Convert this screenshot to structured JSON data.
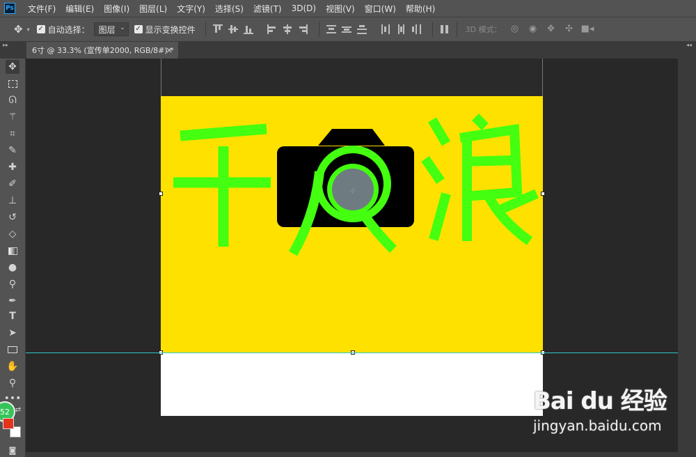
{
  "menubar": {
    "logo": "Ps",
    "items": [
      "文件(F)",
      "编辑(E)",
      "图像(I)",
      "图层(L)",
      "文字(Y)",
      "选择(S)",
      "滤镜(T)",
      "3D(D)",
      "视图(V)",
      "窗口(W)",
      "帮助(H)"
    ]
  },
  "options": {
    "auto_select_label": "自动选择：",
    "auto_select_value": "图层",
    "show_transform_label": "显示变换控件",
    "mode_3d_label": "3D 模式："
  },
  "tab": {
    "title": "6寸 @ 33.3% (宣传单2000, RGB/8#) *",
    "close": "×"
  },
  "badge": "52",
  "artwork": {
    "char_left": "千",
    "char_right": "浪",
    "colors": {
      "background": "#ffe100",
      "text": "#44ff10",
      "camera": "#000000",
      "lens": "#6e7b81"
    }
  },
  "watermark": {
    "logo": "Bai du 经验",
    "url": "jingyan.baidu.com"
  }
}
